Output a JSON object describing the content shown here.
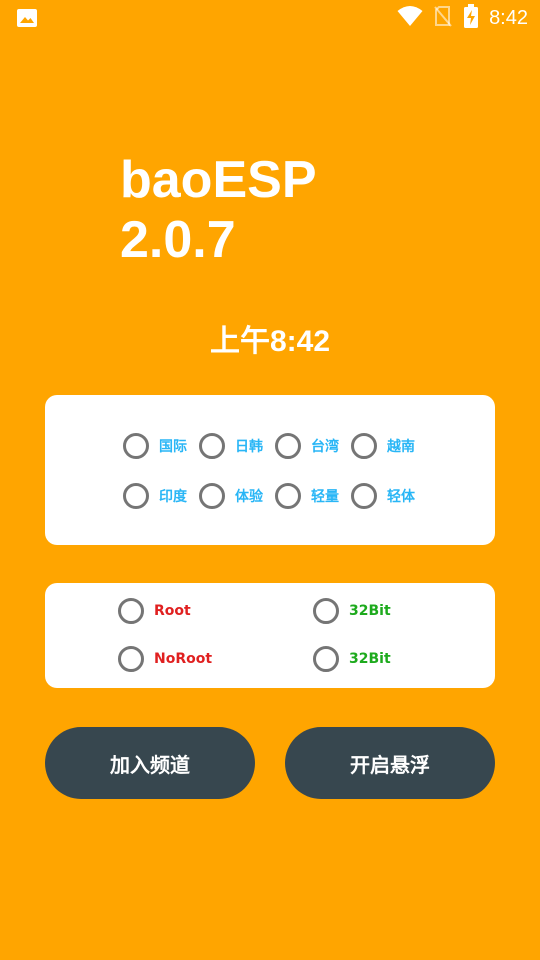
{
  "status_bar": {
    "time": "8:42",
    "icons": [
      "image-icon",
      "wifi-icon",
      "no-sim-icon",
      "battery-charging-icon"
    ]
  },
  "app": {
    "title": "baoESP 2.0.7",
    "clock": "上午8:42"
  },
  "region_options": [
    {
      "label": "国际",
      "selected": false
    },
    {
      "label": "日韩",
      "selected": false
    },
    {
      "label": "台湾",
      "selected": false
    },
    {
      "label": "越南",
      "selected": false
    },
    {
      "label": "印度",
      "selected": false
    },
    {
      "label": "体验",
      "selected": false
    },
    {
      "label": "轻量",
      "selected": false
    },
    {
      "label": "轻体",
      "selected": false
    }
  ],
  "mode_options": [
    {
      "label": "Root",
      "color": "#E02020",
      "selected": false
    },
    {
      "label": "32Bit",
      "color": "#1DAA1D",
      "selected": false
    },
    {
      "label": "NoRoot",
      "color": "#E02020",
      "selected": false
    },
    {
      "label": "32Bit",
      "color": "#1DAA1D",
      "selected": false
    }
  ],
  "buttons": {
    "join_channel": "加入频道",
    "open_float": "开启悬浮"
  },
  "colors": {
    "background": "#FFA500",
    "button": "#37474F",
    "region_label": "#29B6F6"
  }
}
